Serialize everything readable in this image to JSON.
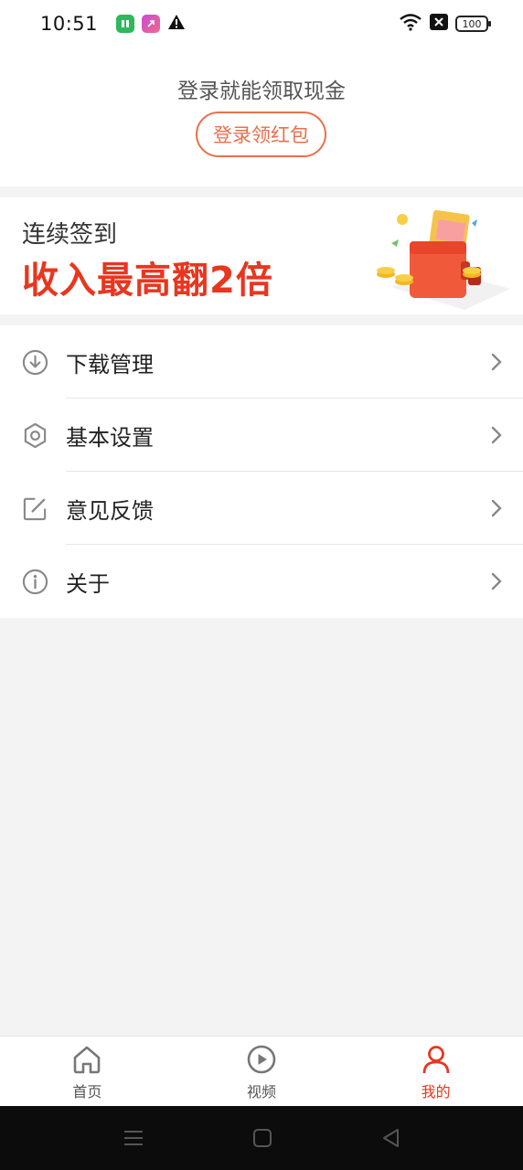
{
  "status_bar": {
    "time": "10:51",
    "battery": "100",
    "icons": [
      "app-green-icon",
      "app-purple-icon",
      "warning-icon",
      "wifi-icon",
      "sim-off-icon",
      "battery-icon"
    ]
  },
  "login": {
    "prompt": "登录就能领取现金",
    "button_label": "登录领红包",
    "accent_color": "#e8704a"
  },
  "banner": {
    "subtitle": "连续签到",
    "headline": "收入最高翻2倍",
    "headline_color": "#e8361f"
  },
  "menu": {
    "items": [
      {
        "label": "下载管理",
        "icon": "download-icon"
      },
      {
        "label": "基本设置",
        "icon": "settings-hexagon-icon"
      },
      {
        "label": "意见反馈",
        "icon": "edit-feedback-icon"
      },
      {
        "label": "关于",
        "icon": "info-icon"
      }
    ]
  },
  "tabs": {
    "items": [
      {
        "label": "首页",
        "icon": "home-icon",
        "active": false
      },
      {
        "label": "视频",
        "icon": "play-circle-icon",
        "active": false
      },
      {
        "label": "我的",
        "icon": "user-icon",
        "active": true
      }
    ],
    "active_color": "#e8361f"
  },
  "system_nav": {
    "buttons": [
      "menu-icon",
      "home-square-icon",
      "back-triangle-icon"
    ]
  }
}
